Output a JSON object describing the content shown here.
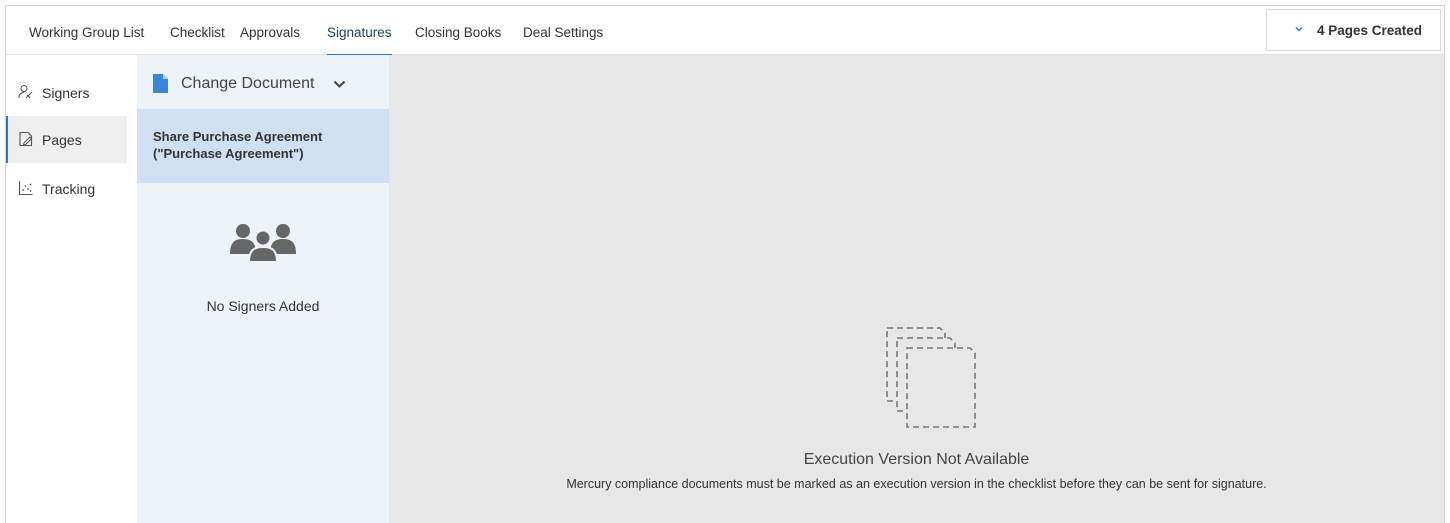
{
  "nav": {
    "tabs": [
      {
        "label": "Working Group List"
      },
      {
        "label": "Checklist"
      },
      {
        "label": "Approvals"
      },
      {
        "label": "Signatures",
        "active": true
      },
      {
        "label": "Closing Books"
      },
      {
        "label": "Deal Settings"
      }
    ],
    "pages_created": "4 Pages Created",
    "pages_created_icon": "chevron-down-icon"
  },
  "sidebar": {
    "items": [
      {
        "label": "Signers",
        "icon": "signers-icon"
      },
      {
        "label": "Pages",
        "icon": "pages-edit-icon",
        "active": true
      },
      {
        "label": "Tracking",
        "icon": "tracking-chart-icon"
      }
    ]
  },
  "document_panel": {
    "change_label": "Change Document",
    "selected_document": "Share Purchase Agreement (\"Purchase Agreement\")",
    "empty_signers": "No Signers Added"
  },
  "main": {
    "empty_title": "Execution Version Not Available",
    "empty_description": "Mercury compliance documents must be marked as an execution version in the checklist before they can be sent for signature."
  },
  "colors": {
    "accent": "#2d79c7",
    "doc_panel_bg": "#eef3f9",
    "doc_selected_bg": "#cfe0f4",
    "main_bg": "#e7e7e7",
    "file_icon": "#3b86d6"
  }
}
